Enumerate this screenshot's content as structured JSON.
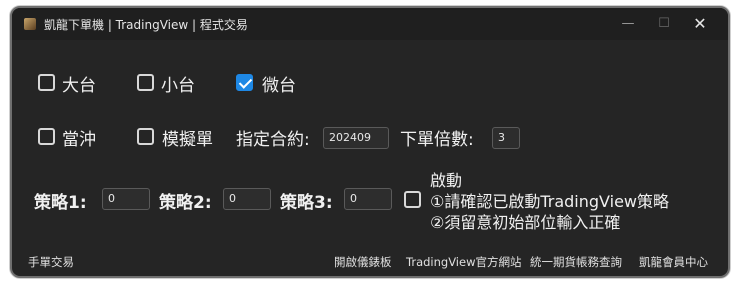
{
  "window": {
    "title": "凱龍下單機 | TradingView | 程式交易",
    "minimize_icon": "minimize-icon",
    "maximize_icon": "maximize-icon",
    "close_icon": "close-icon",
    "min_glyph": "—",
    "max_glyph": "☐",
    "close_glyph": "✕"
  },
  "contracts": [
    {
      "label": "大台",
      "checked": false
    },
    {
      "label": "小台",
      "checked": false
    },
    {
      "label": "微台",
      "checked": true
    }
  ],
  "options": {
    "daytrade_label": "當沖",
    "simulate_label": "模擬單",
    "contract_label": "指定合約:",
    "contract_value": "202409",
    "multiplier_label": "下單倍數:",
    "multiplier_value": "3"
  },
  "strategies": [
    {
      "label": "策略1:",
      "value": "0"
    },
    {
      "label": "策略2:",
      "value": "0"
    },
    {
      "label": "策略3:",
      "value": "0"
    }
  ],
  "start": {
    "label": "啟動",
    "note1": "①請確認已啟動TradingView策略",
    "note2": "②須留意初始部位輸入正確",
    "checked": false
  },
  "footer": {
    "manual": "手單交易",
    "dashboard": "開啟儀錶板",
    "tv_site": "TradingView官方網站",
    "account": "統一期貨帳務查詢",
    "member": "凱龍會員中心"
  },
  "colors": {
    "background": "#252525",
    "accent": "#1e88e5",
    "text": "#f0f0f0"
  }
}
